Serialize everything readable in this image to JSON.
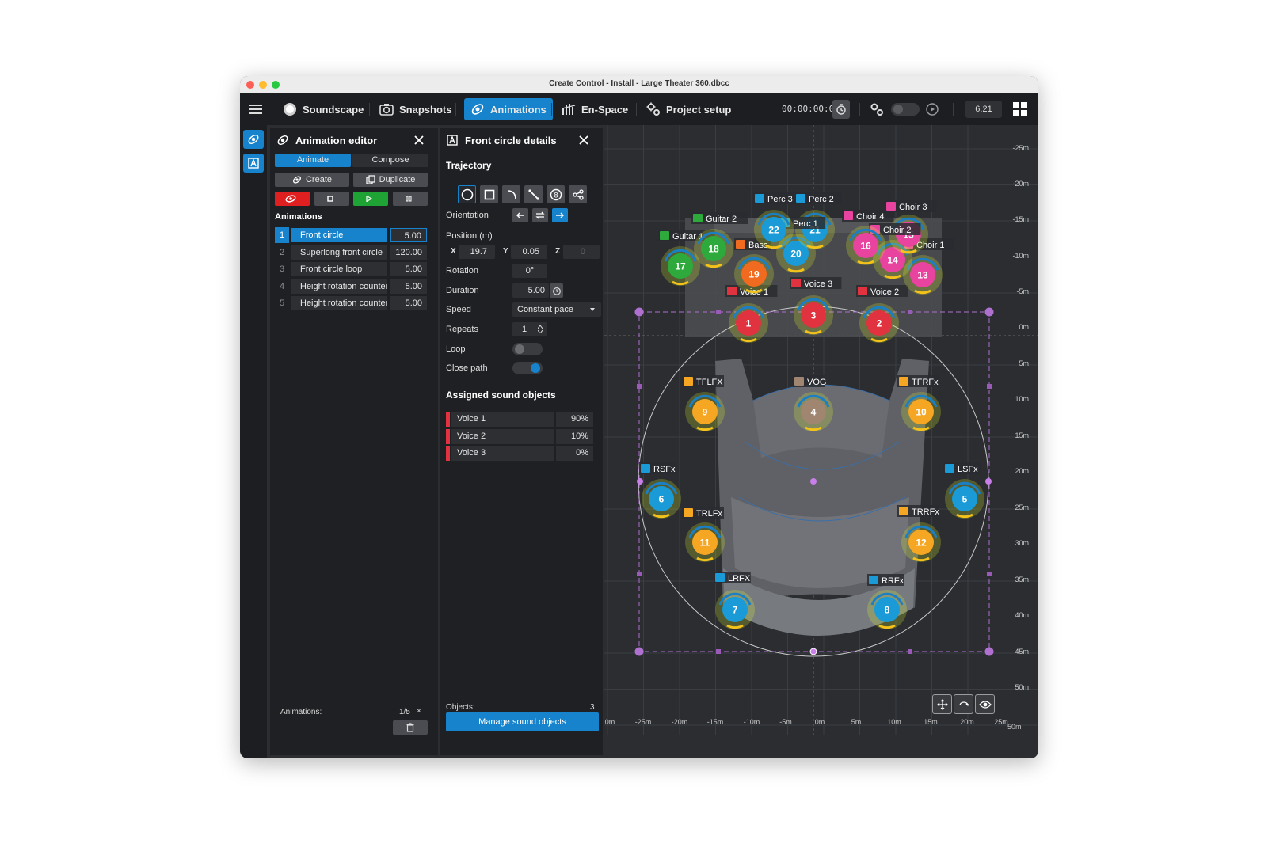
{
  "window": {
    "title": "Create Control - Install - Large Theater 360.dbcc"
  },
  "toolbar": {
    "soundscape": "Soundscape",
    "snapshots": "Snapshots",
    "animations": "Animations",
    "enspace": "En-Space",
    "project_setup": "Project setup",
    "timecode": "00:00:00:00",
    "version": "6.21"
  },
  "animation_editor": {
    "title": "Animation editor",
    "tab_animate": "Animate",
    "tab_compose": "Compose",
    "create": "Create",
    "duplicate": "Duplicate",
    "section": "Animations",
    "items": [
      {
        "num": "1",
        "name": "Front circle",
        "value": "5.00"
      },
      {
        "num": "2",
        "name": "Superlong front circle",
        "value": "120.00"
      },
      {
        "num": "3",
        "name": "Front circle loop",
        "value": "5.00"
      },
      {
        "num": "4",
        "name": "Height rotation counter",
        "value": "5.00"
      },
      {
        "num": "5",
        "name": "Height rotation counter",
        "value": "5.00"
      }
    ],
    "footer_label": "Animations:",
    "footer_count": "1/5",
    "footer_x": "×"
  },
  "details": {
    "title": "Front circle details",
    "trajectory": "Trajectory",
    "orientation": "Orientation",
    "position": "Position (m)",
    "pos_x_label": "X",
    "pos_x": "19.7",
    "pos_y_label": "Y",
    "pos_y": "0.05",
    "pos_z_label": "Z",
    "pos_z": "0",
    "rotation": "Rotation",
    "rotation_val": "0°",
    "duration": "Duration",
    "duration_val": "5.00",
    "speed": "Speed",
    "speed_val": "Constant pace",
    "repeats": "Repeats",
    "repeats_val": "1",
    "loop": "Loop",
    "loop_on": false,
    "close_path": "Close path",
    "close_path_on": true,
    "assigned": "Assigned sound objects",
    "objects": [
      {
        "name": "Voice 1",
        "value": "90%"
      },
      {
        "name": "Voice 2",
        "value": "10%"
      },
      {
        "name": "Voice 3",
        "value": "0%"
      }
    ],
    "objects_label": "Objects:",
    "objects_count": "3",
    "manage": "Manage sound objects"
  },
  "stage": {
    "y_ticks": [
      "-25m",
      "-20m",
      "-15m",
      "-10m",
      "-5m",
      "0m",
      "5m",
      "10m",
      "15m",
      "20m",
      "25m",
      "30m",
      "35m",
      "40m",
      "45m",
      "50m"
    ],
    "x_ticks": [
      "0m",
      "-25m",
      "-20m",
      "-15m",
      "-10m",
      "-5m",
      "0m",
      "5m",
      "10m",
      "15m",
      "20m",
      "25m"
    ],
    "corner_tick": "50m",
    "sound_objects": [
      {
        "num": "1",
        "label": "Voice 1",
        "color": "#e0323f"
      },
      {
        "num": "2",
        "label": "Voice 2",
        "color": "#e0323f"
      },
      {
        "num": "3",
        "label": "Voice 3",
        "color": "#e0323f"
      },
      {
        "num": "4",
        "label": "VOG",
        "color": "#a08670"
      },
      {
        "num": "5",
        "label": "LSFx",
        "color": "#1a9ad6"
      },
      {
        "num": "6",
        "label": "RSFx",
        "color": "#1a9ad6"
      },
      {
        "num": "7",
        "label": "LRFX",
        "color": "#1a9ad6"
      },
      {
        "num": "8",
        "label": "RRFx",
        "color": "#1a9ad6"
      },
      {
        "num": "9",
        "label": "TFLFX",
        "color": "#f5a623"
      },
      {
        "num": "10",
        "label": "TFRFx",
        "color": "#f5a623"
      },
      {
        "num": "11",
        "label": "TRLFx",
        "color": "#f5a623"
      },
      {
        "num": "12",
        "label": "TRRFx",
        "color": "#f5a623"
      },
      {
        "num": "13",
        "label": "Choir 1",
        "color": "#e8449f"
      },
      {
        "num": "14",
        "label": "",
        "color": "#e8449f"
      },
      {
        "num": "15",
        "label": "Choir 2",
        "color": "#e8449f"
      },
      {
        "num": "16",
        "label": "Choir 4",
        "color": "#e8449f"
      },
      {
        "num": "17",
        "label": "Guitar 1",
        "color": "#2eaa3c"
      },
      {
        "num": "18",
        "label": "Guitar 2",
        "color": "#2eaa3c"
      },
      {
        "num": "19",
        "label": "Bass",
        "color": "#f06a1f"
      },
      {
        "num": "20",
        "label": "",
        "color": "#1a9ad6"
      },
      {
        "num": "21",
        "label": "Perc 1",
        "color": "#1a9ad6"
      },
      {
        "num": "22",
        "label": "Perc 3",
        "color": "#1a9ad6"
      }
    ],
    "extra_labels": [
      {
        "label": "Perc 2",
        "color": "#1a9ad6"
      },
      {
        "label": "Choir 3",
        "color": "#e8449f"
      }
    ]
  }
}
